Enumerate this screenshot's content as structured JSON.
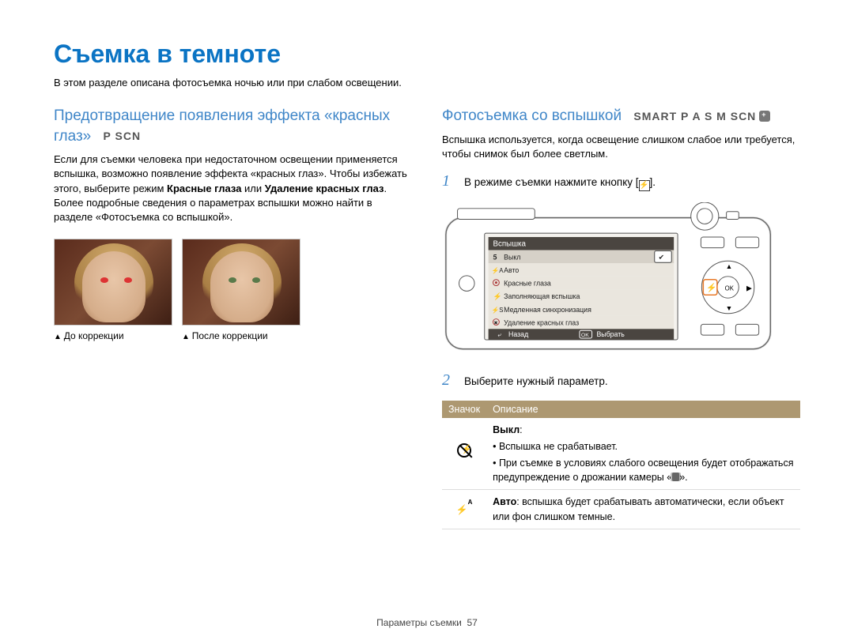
{
  "title": "Съемка в темноте",
  "intro": "В этом разделе описана фотосъемка ночью или при слабом освещении.",
  "left": {
    "heading": "Предотвращение появления эффекта «красных глаз»",
    "modes": "P SCN",
    "text1": "Если для съемки человека при недостаточном освещении применяется вспышка, возможно появление эффекта «красных глаз». Чтобы избежать этого, выберите режим ",
    "boldpart": "Красные глаза",
    "or": " или ",
    "boldpart2": "Удаление красных глаз",
    "text2": ". Более подробные сведения о параметрах вспышки можно найти в разделе «Фотосъемка со вспышкой».",
    "cap1": "До коррекции",
    "cap2": "После коррекции"
  },
  "right": {
    "heading": "Фотосъемка со вспышкой",
    "modes": "SMART P A S M SCN",
    "intro": "Вспышка используется, когда освещение слишком слабое или требуется, чтобы снимок был более светлым.",
    "step1": "В режиме съемки нажмите кнопку [",
    "step1b": "].",
    "step2": "Выберите нужный параметр.",
    "menu": {
      "title": "Вспышка",
      "items": [
        "Выкл",
        "Авто",
        "Красные глаза",
        "Заполняющая вспышка",
        "Медленная синхронизация",
        "Удаление красных глаз"
      ],
      "back": "Назад",
      "select": "Выбрать"
    },
    "table": {
      "h1": "Значок",
      "h2": "Описание",
      "row1_title": "Выкл",
      "row1_l1": "Вспышка не срабатывает.",
      "row1_l2a": "При съемке в условиях слабого освещения будет отображаться предупреждение о дрожании камеры ",
      "row1_l2b": ".",
      "row2_title": "Авто",
      "row2_text": ": вспышка будет срабатывать автоматически, если объект или фон слишком темные."
    }
  },
  "footer": "Параметры съемки",
  "page": "57"
}
